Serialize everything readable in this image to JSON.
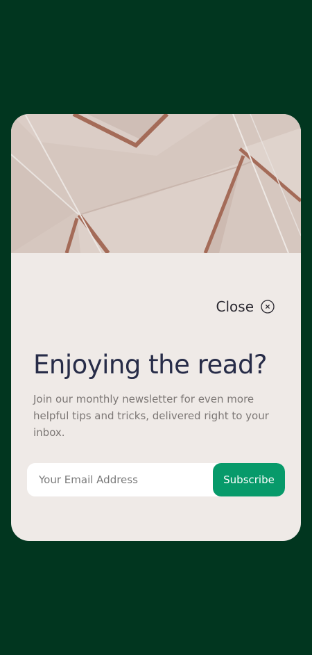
{
  "colors": {
    "page_background": "#01361f",
    "card_background": "#efeae7",
    "headline": "#272c48",
    "body_text": "#7c7775",
    "accent": "#079a6a"
  },
  "hero": {
    "icon": "envelopes-photo"
  },
  "close": {
    "label": "Close",
    "icon": "close-circle-icon"
  },
  "headline": "Enjoying the read?",
  "subtext": "Join our monthly newsletter for even more helpful tips and tricks, delivered right to your inbox.",
  "form": {
    "email_placeholder": "Your Email Address",
    "email_value": "",
    "subscribe_label": "Subscribe"
  }
}
